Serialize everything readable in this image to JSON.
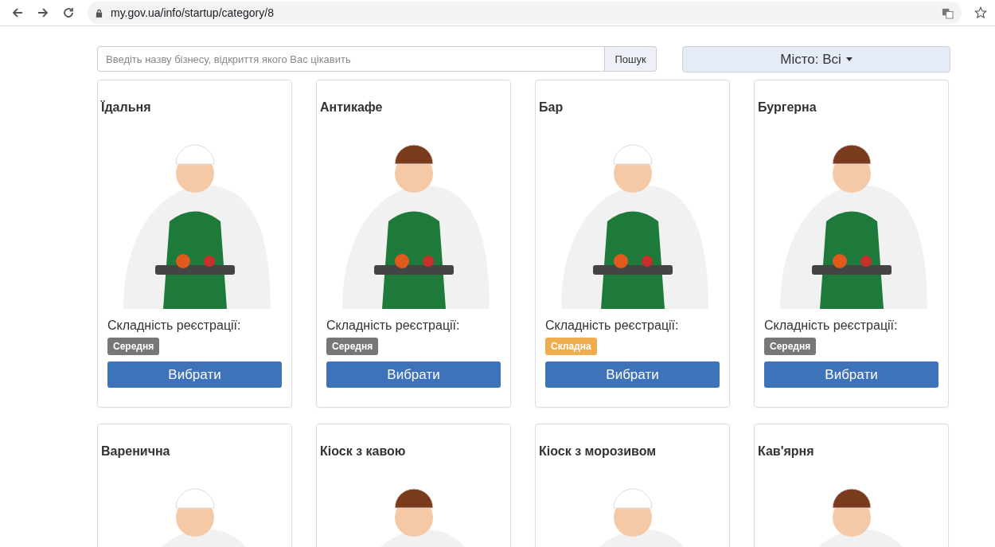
{
  "browser": {
    "url": "my.gov.ua/info/startup/category/8"
  },
  "search": {
    "placeholder": "Введіть назву бізнесу, відкриття якого Вас цікавить",
    "button": "Пошук"
  },
  "city_filter": {
    "label": "Місто: Всі"
  },
  "cards": [
    {
      "title": "Їдальня",
      "difficulty_caption": "Складність реєстрації:",
      "difficulty": "Середня",
      "kind": "medium",
      "button": "Вибрати"
    },
    {
      "title": "Антикафе",
      "difficulty_caption": "Складність реєстрації:",
      "difficulty": "Середня",
      "kind": "medium",
      "button": "Вибрати"
    },
    {
      "title": "Бар",
      "difficulty_caption": "Складність реєстрації:",
      "difficulty": "Складна",
      "kind": "hard",
      "button": "Вибрати"
    },
    {
      "title": "Бургерна",
      "difficulty_caption": "Складність реєстрації:",
      "difficulty": "Середня",
      "kind": "medium",
      "button": "Вибрати"
    },
    {
      "title": "Варенична"
    },
    {
      "title": "Кіоск з кавою"
    },
    {
      "title": "Кіоск з морозивом"
    },
    {
      "title": "Кав'ярня"
    }
  ]
}
